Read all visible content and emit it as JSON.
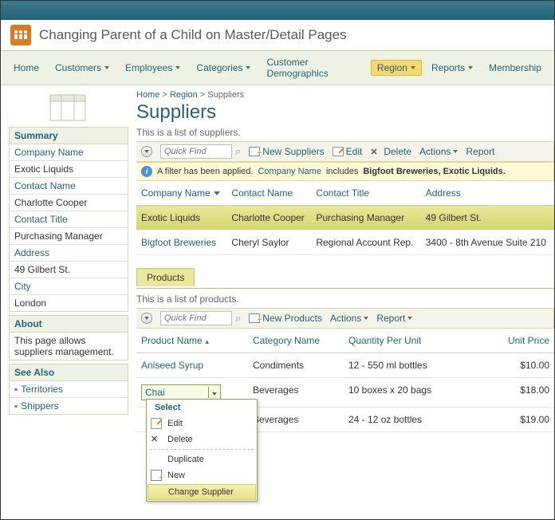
{
  "app_title": "Changing Parent of a Child on Master/Detail Pages",
  "menu": {
    "home": "Home",
    "customers": "Customers",
    "employees": "Employees",
    "categories": "Categories",
    "customer_demo": "Customer Demographics",
    "region": "Region",
    "reports": "Reports",
    "membership": "Membership"
  },
  "breadcrumb": {
    "home": "Home",
    "region": "Region",
    "leaf": "Suppliers"
  },
  "heading": "Suppliers",
  "summary": {
    "title": "Summary",
    "fields": [
      {
        "label": "Company Name",
        "value": "Exotic Liquids"
      },
      {
        "label": "Contact Name",
        "value": "Charlotte Cooper"
      },
      {
        "label": "Contact Title",
        "value": "Purchasing Manager"
      },
      {
        "label": "Address",
        "value": "49 Gilbert St."
      },
      {
        "label": "City",
        "value": "London"
      }
    ]
  },
  "about": {
    "title": "About",
    "text": "This page allows suppliers management."
  },
  "seealso": {
    "title": "See Also",
    "items": [
      "Territories",
      "Shippers"
    ]
  },
  "suppliers": {
    "caption": "This is a list of suppliers.",
    "quickfind": "Quick Find",
    "toolbar": {
      "new": "New Suppliers",
      "edit": "Edit",
      "delete": "Delete",
      "actions": "Actions",
      "report": "Report"
    },
    "filter": {
      "prefix": "A filter has been applied.",
      "field": "Company Name",
      "includes_word": "includes",
      "values": "Bigfoot Breweries, Exotic Liquids."
    },
    "headers": {
      "company": "Company Name",
      "contact": "Contact Name",
      "title": "Contact Title",
      "address": "Address"
    },
    "rows": [
      {
        "company": "Exotic Liquids",
        "contact": "Charlotte Cooper",
        "title": "Purchasing Manager",
        "address": "49 Gilbert St."
      },
      {
        "company": "Bigfoot Breweries",
        "contact": "Cheryl Saylor",
        "title": "Regional Account Rep.",
        "address": "3400 - 8th Avenue Suite 210"
      }
    ]
  },
  "products": {
    "tab": "Products",
    "caption": "This is a list of products.",
    "quickfind": "Quick Find",
    "toolbar": {
      "new": "New Products",
      "actions": "Actions",
      "report": "Report"
    },
    "headers": {
      "product": "Product Name",
      "category": "Category Name",
      "qty": "Quantity Per Unit",
      "price": "Unit Price"
    },
    "rows": [
      {
        "product": "Aniseed Syrup",
        "category": "Condiments",
        "qty": "12 - 550 ml bottles",
        "price": "$10.00"
      },
      {
        "product": "Chai",
        "category": "Beverages",
        "qty": "10 boxes x 20 bags",
        "price": "$18.00"
      },
      {
        "product": "",
        "category": "Beverages",
        "qty": "24 - 12 oz bottles",
        "price": "$19.00"
      }
    ]
  },
  "contextmenu": {
    "select": "Select",
    "edit": "Edit",
    "delete": "Delete",
    "duplicate": "Duplicate",
    "new": "New",
    "change": "Change Supplier"
  }
}
